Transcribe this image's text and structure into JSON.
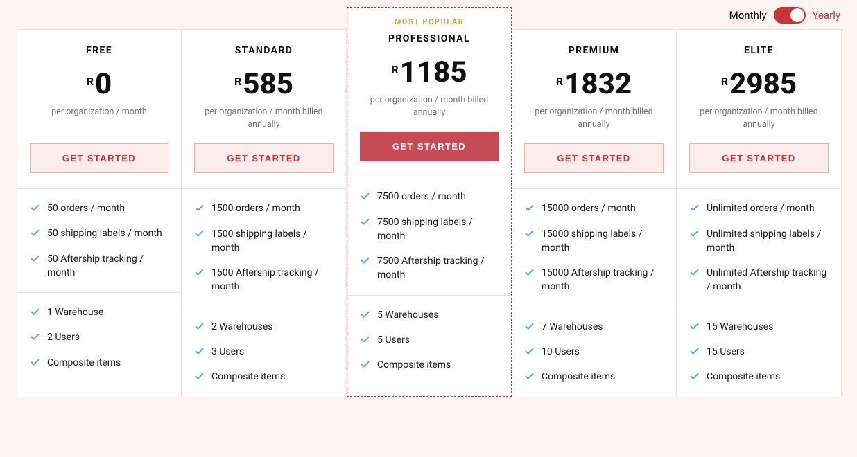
{
  "toggle": {
    "monthly": "Monthly",
    "yearly": "Yearly"
  },
  "currency": "R",
  "cta": "GET STARTED",
  "popular_badge": "MOST POPULAR",
  "plans": [
    {
      "name": "FREE",
      "price": "0",
      "subtext": "per organization / month",
      "popular": false,
      "features1": [
        "50 orders / month",
        "50 shipping labels / month",
        "50 Aftership tracking / month"
      ],
      "features2": [
        "1 Warehouse",
        "2 Users",
        "Composite items"
      ]
    },
    {
      "name": "STANDARD",
      "price": "585",
      "subtext": "per organization / month billed annually",
      "popular": false,
      "features1": [
        "1500 orders / month",
        "1500 shipping labels / month",
        "1500 Aftership tracking / month"
      ],
      "features2": [
        "2 Warehouses",
        "3 Users",
        "Composite items"
      ]
    },
    {
      "name": "PROFESSIONAL",
      "price": "1185",
      "subtext": "per organization / month billed annually",
      "popular": true,
      "features1": [
        "7500 orders / month",
        "7500 shipping labels / month",
        "7500 Aftership tracking / month"
      ],
      "features2": [
        "5 Warehouses",
        "5 Users",
        "Composite items"
      ]
    },
    {
      "name": "PREMIUM",
      "price": "1832",
      "subtext": "per organization / month billed annually",
      "popular": false,
      "features1": [
        "15000 orders / month",
        "15000 shipping labels / month",
        "15000 Aftership tracking / month"
      ],
      "features2": [
        "7 Warehouses",
        "10 Users",
        "Composite items"
      ]
    },
    {
      "name": "ELITE",
      "price": "2985",
      "subtext": "per organization / month billed annually",
      "popular": false,
      "features1": [
        "Unlimited orders / month",
        "Unlimited shipping labels / month",
        "Unlimited Aftership tracking / month"
      ],
      "features2": [
        "15 Warehouses",
        "15 Users",
        "Composite items"
      ]
    }
  ]
}
